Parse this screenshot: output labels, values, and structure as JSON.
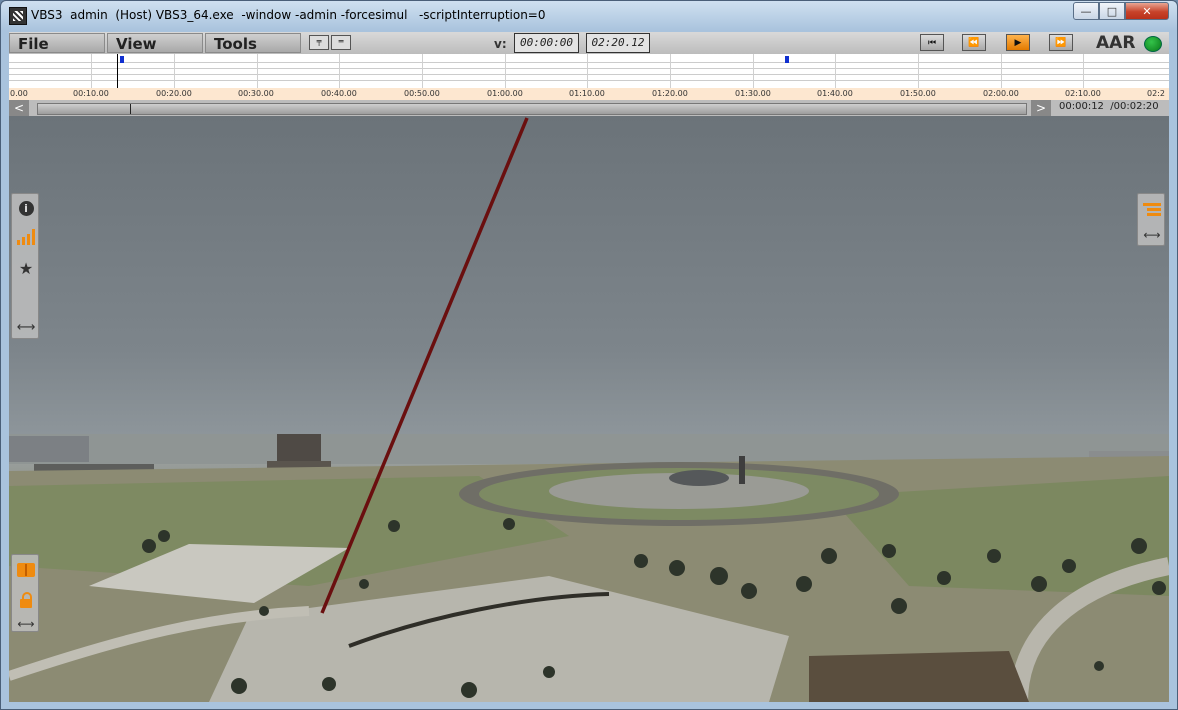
{
  "window": {
    "title": "VBS3  admin  (Host) VBS3_64.exe  -window -admin -forcesimul   -scriptInterruption=0",
    "minimize_glyph": "—",
    "maximize_glyph": "□",
    "close_glyph": "✕"
  },
  "menu": {
    "file": "File",
    "view": "View",
    "tools": "Tools"
  },
  "aar": {
    "v_label": "v:",
    "time_current": "00:00:00",
    "time_total": "02:20.12",
    "label": "AAR",
    "status_color": "#1aa32a",
    "playback": [
      {
        "name": "skip-start",
        "glyph": "⏮",
        "active": false
      },
      {
        "name": "rewind",
        "glyph": "⏪",
        "active": false
      },
      {
        "name": "play",
        "glyph": "▶",
        "active": true
      },
      {
        "name": "fast-forward",
        "glyph": "⏩",
        "active": false
      }
    ]
  },
  "timeline": {
    "ruler_labels": [
      "0.00",
      "00:10.00",
      "00:20.00",
      "00:30.00",
      "00:40.00",
      "00:50.00",
      "01:00.00",
      "01:10.00",
      "01:20.00",
      "01:30.00",
      "01:40.00",
      "01:50.00",
      "02:00.00",
      "02:10.00",
      "02:2"
    ],
    "scroll_left": "<",
    "scroll_right": ">",
    "readout": "00:00:12  /00:02:20"
  },
  "left_panel_top": {
    "icons": [
      "info-icon",
      "chart-icon",
      "star-icon",
      "resize-icon"
    ]
  },
  "left_panel_bottom": {
    "icons": [
      "book-icon",
      "lock-icon",
      "resize-icon"
    ]
  },
  "right_panel": {
    "icons": [
      "layers-icon",
      "resize-icon"
    ]
  },
  "colors": {
    "accent": "#ef8b10",
    "tracer_line": "#6a0f0f"
  }
}
